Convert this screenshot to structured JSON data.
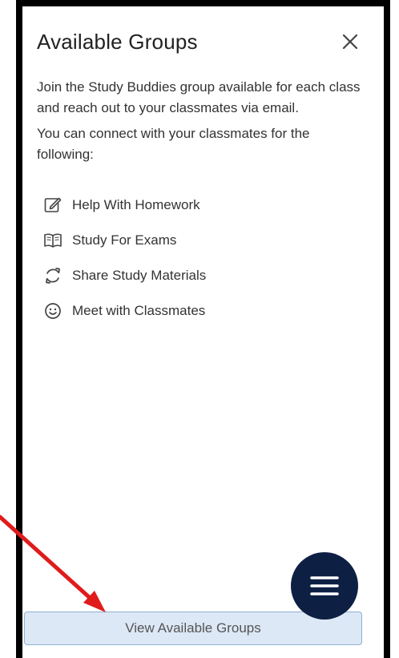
{
  "dialog": {
    "title": "Available Groups",
    "intro_paragraphs": [
      "Join the Study Buddies group available for each class and reach out to your classmates via email.",
      "You can connect with your classmates for the following:"
    ],
    "features": [
      {
        "label": "Help With Homework",
        "icon": "edit-icon"
      },
      {
        "label": "Study For Exams",
        "icon": "book-icon"
      },
      {
        "label": "Share Study Materials",
        "icon": "sync-icon"
      },
      {
        "label": "Meet with Classmates",
        "icon": "smiley-icon"
      }
    ]
  },
  "view_button_label": "View Available Groups",
  "colors": {
    "fab_background": "#0e1f44",
    "button_background": "#dce8f5",
    "button_border": "#8fb0d4",
    "annotation_arrow": "#e01b1b"
  }
}
